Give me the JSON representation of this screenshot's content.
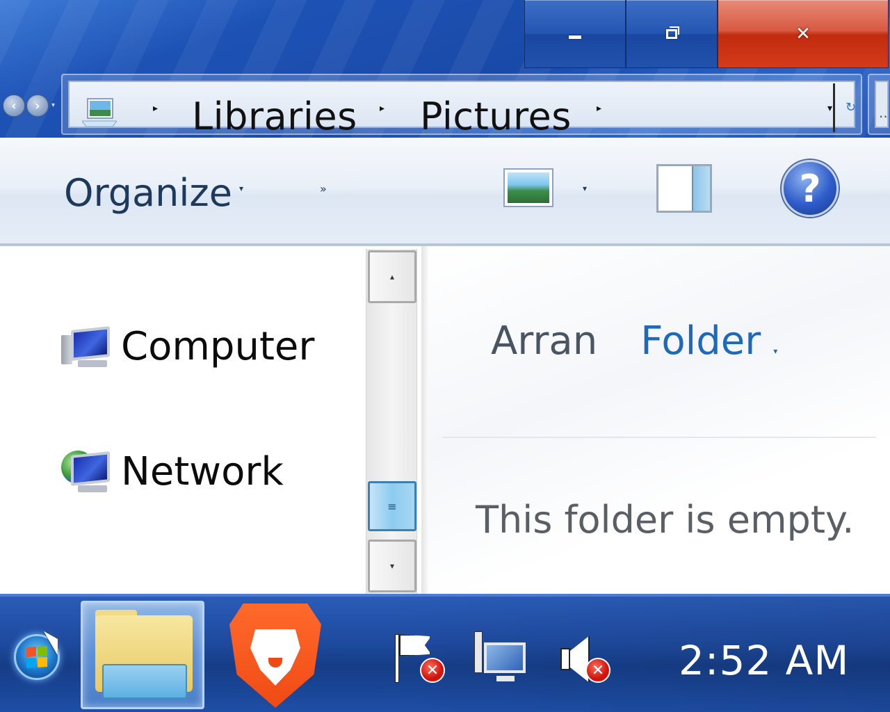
{
  "window": {
    "caption_buttons": [
      {
        "name": "minimize",
        "icon": "minimize-icon"
      },
      {
        "name": "maximize",
        "icon": "restore-icon"
      },
      {
        "name": "close",
        "icon": "close-icon"
      }
    ]
  },
  "address_bar": {
    "icon": "pictures-library-icon",
    "breadcrumb": [
      "Libraries",
      "Pictures"
    ]
  },
  "toolbar": {
    "organize_label": "Organize",
    "more_icon": "chevron-double-right-icon",
    "view_icon": "change-view-icon",
    "preview_pane_icon": "preview-pane-icon",
    "help_glyph": "?"
  },
  "nav_pane": {
    "items": [
      {
        "label": "Computer",
        "icon": "computer-icon"
      },
      {
        "label": "Network",
        "icon": "network-icon"
      }
    ]
  },
  "content": {
    "library_owner": "Arran",
    "arrange_by_label": "Folder",
    "empty_message": "This folder is empty."
  },
  "taskbar": {
    "pinned": [
      {
        "name": "windows-explorer",
        "icon": "folder-icon"
      },
      {
        "name": "brave-browser",
        "icon": "brave-icon"
      }
    ],
    "tray_icons": [
      {
        "name": "action-center",
        "icon": "flag-icon",
        "status": "error"
      },
      {
        "name": "network",
        "icon": "network-monitor-icon"
      },
      {
        "name": "volume",
        "icon": "speaker-icon",
        "status": "error"
      }
    ],
    "clock": "2:52 AM"
  },
  "colors": {
    "accent_blue": "#1f6ab8",
    "title_blue": "#1d52b5",
    "close_red": "#c22b0e"
  }
}
